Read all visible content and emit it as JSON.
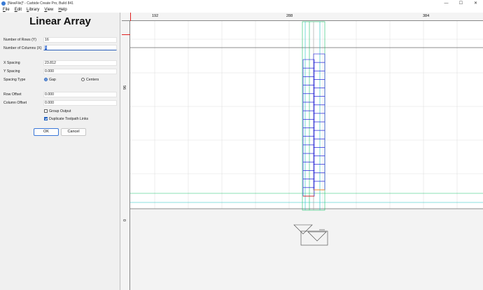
{
  "window": {
    "title": "[NewFile]* - Carbide Create Pro, Build 841",
    "minimize_glyph": "—",
    "maximize_glyph": "☐",
    "close_glyph": "✕"
  },
  "menu": [
    "File",
    "Edit",
    "Library",
    "View",
    "Help"
  ],
  "panel": {
    "title": "Linear Array",
    "rows_label": "Number of Rows (Y)",
    "rows_value": "16",
    "cols_label": "Number of Columns (X)",
    "cols_value": "1",
    "x_spacing_label": "X Spacing",
    "x_spacing_value": "23.812",
    "y_spacing_label": "Y Spacing",
    "y_spacing_value": "0.000",
    "spacing_type_label": "Spacing Type",
    "spacing_gap": "Gap",
    "spacing_centers": "Centers",
    "spacing_selected": "Gap",
    "row_offset_label": "Row Offset",
    "row_offset_value": "0.000",
    "col_offset_label": "Column Offset",
    "col_offset_value": "0.000",
    "group_output_label": "Group Output",
    "group_output_checked": false,
    "duplicate_links_label": "Duplicate Toolpath Links",
    "duplicate_links_checked": true,
    "ok_label": "OK",
    "cancel_label": "Cancel"
  },
  "rulers": {
    "top": [
      "192",
      "288",
      "384"
    ],
    "left": [
      "96",
      "0"
    ]
  },
  "colors": {
    "accent": "#1f5fbf",
    "array_blue": "#1a1adb",
    "guide_green": "#19c26a",
    "guide_cyan": "#19c2c2",
    "highlight_red": "#e02020",
    "highlight_orange": "#ff8c1a"
  }
}
